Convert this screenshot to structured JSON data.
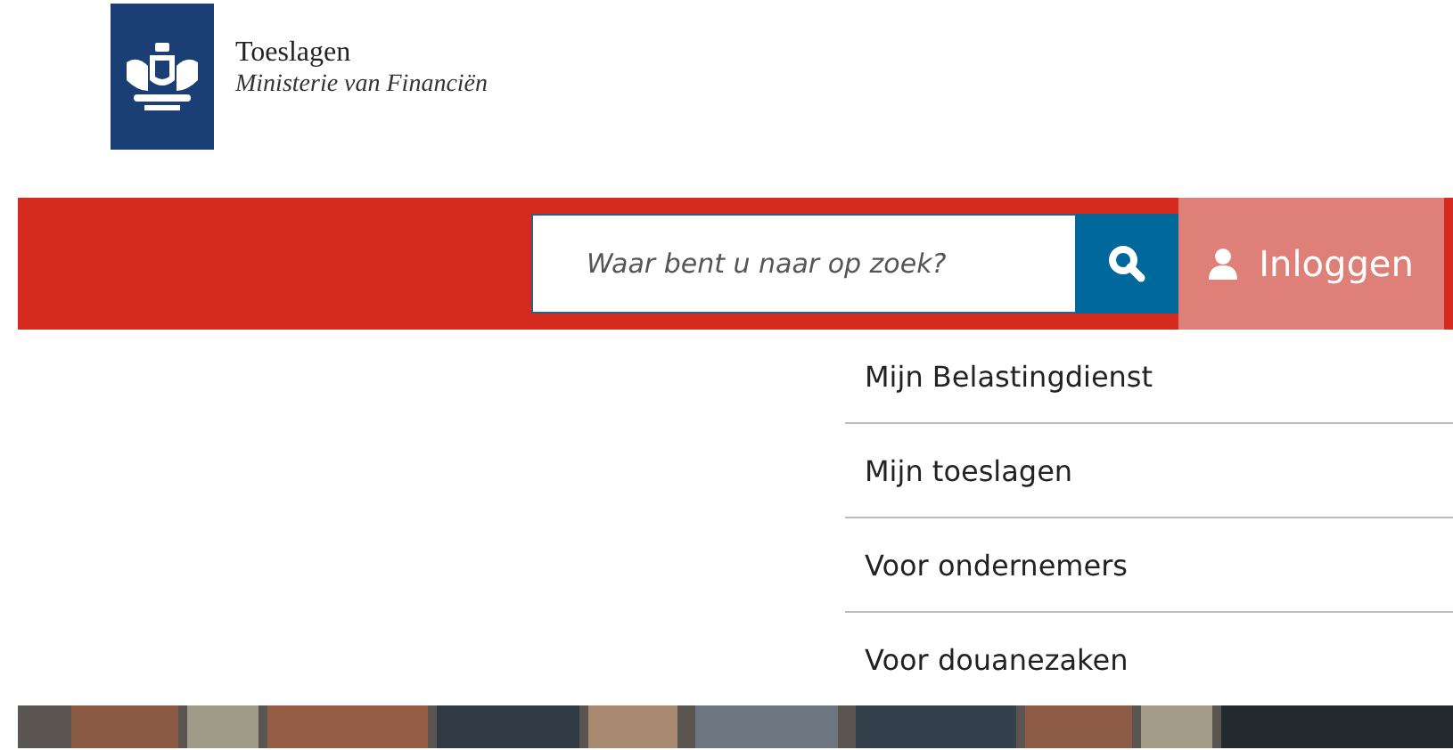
{
  "logo": {
    "title": "Toeslagen",
    "subtitle": "Ministerie van Financiën"
  },
  "search": {
    "placeholder": "Waar bent u naar op zoek?"
  },
  "login": {
    "label": "Inloggen",
    "expanded": true
  },
  "menu": [
    {
      "label": "Mijn Belastingdienst"
    },
    {
      "label": "Mijn toeslagen"
    },
    {
      "label": "Voor ondernemers"
    },
    {
      "label": "Voor douanezaken"
    }
  ]
}
